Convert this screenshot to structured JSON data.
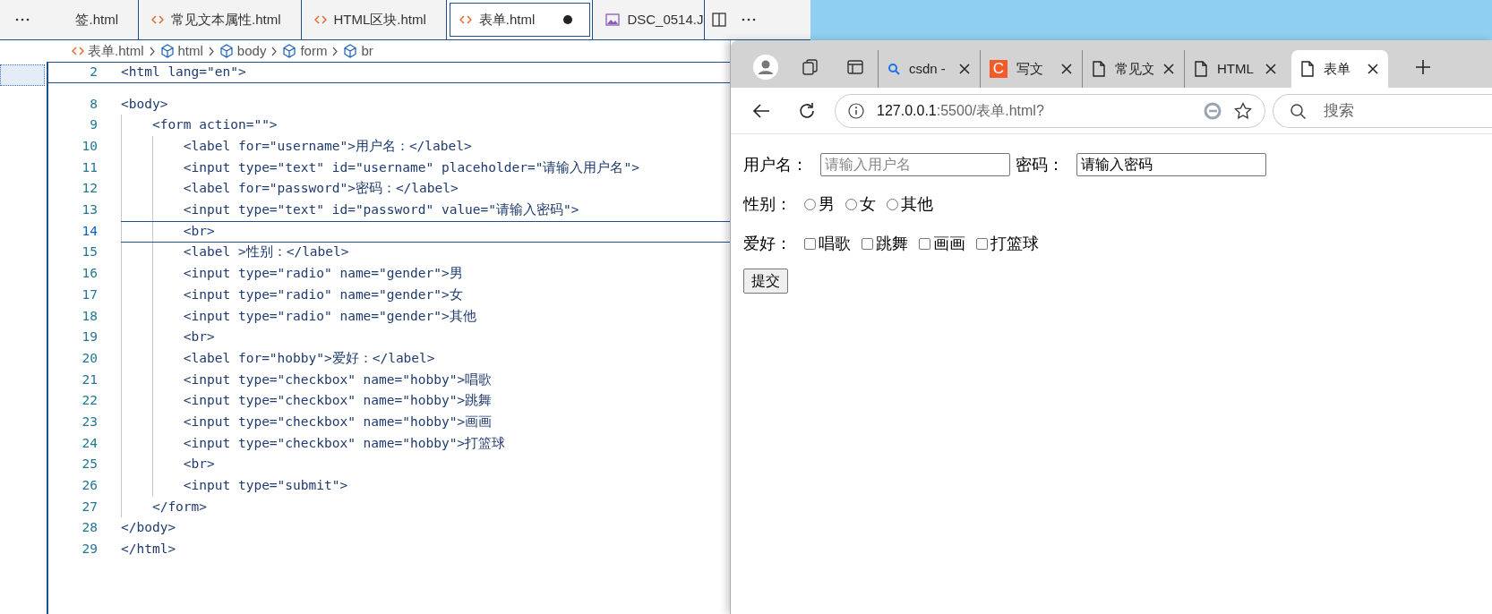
{
  "editor": {
    "tabs": [
      {
        "label": "签.html",
        "selected": false,
        "dirty": false
      },
      {
        "label": "常见文本属性.html",
        "kind": "code",
        "selected": false,
        "dirty": false
      },
      {
        "label": "HTML区块.html",
        "kind": "code",
        "selected": false,
        "dirty": false
      },
      {
        "label": "表单.html",
        "kind": "code",
        "selected": true,
        "dirty": true
      },
      {
        "label": "DSC_0514.J",
        "kind": "image",
        "selected": false,
        "dirty": false
      }
    ],
    "breadcrumbs": [
      {
        "label": "表单.html",
        "kind": "file"
      },
      {
        "label": "html",
        "kind": "element"
      },
      {
        "label": "body",
        "kind": "element"
      },
      {
        "label": "form",
        "kind": "element"
      },
      {
        "label": "br",
        "kind": "element"
      }
    ],
    "sticky_line": {
      "number": "2",
      "text": "<html lang=\"en\">"
    },
    "lines": [
      {
        "number": "8",
        "text": "<body>",
        "current": false
      },
      {
        "number": "9",
        "text": "    <form action=\"\">",
        "current": false
      },
      {
        "number": "10",
        "text": "        <label for=\"username\">用户名：</label>",
        "current": false
      },
      {
        "number": "11",
        "text": "        <input type=\"text\" id=\"username\" placeholder=\"请输入用户名\">",
        "current": false
      },
      {
        "number": "12",
        "text": "        <label for=\"password\">密码：</label>",
        "current": false
      },
      {
        "number": "13",
        "text": "        <input type=\"text\" id=\"password\" value=\"请输入密码\">",
        "current": false
      },
      {
        "number": "14",
        "text": "        <br>",
        "current": true
      },
      {
        "number": "15",
        "text": "        <label >性别：</label>",
        "current": false
      },
      {
        "number": "16",
        "text": "        <input type=\"radio\" name=\"gender\">男",
        "current": false
      },
      {
        "number": "17",
        "text": "        <input type=\"radio\" name=\"gender\">女",
        "current": false
      },
      {
        "number": "18",
        "text": "        <input type=\"radio\" name=\"gender\">其他",
        "current": false
      },
      {
        "number": "19",
        "text": "        <br>",
        "current": false
      },
      {
        "number": "20",
        "text": "        <label for=\"hobby\">爱好：</label>",
        "current": false
      },
      {
        "number": "21",
        "text": "        <input type=\"checkbox\" name=\"hobby\">唱歌",
        "current": false
      },
      {
        "number": "22",
        "text": "        <input type=\"checkbox\" name=\"hobby\">跳舞",
        "current": false
      },
      {
        "number": "23",
        "text": "        <input type=\"checkbox\" name=\"hobby\">画画",
        "current": false
      },
      {
        "number": "24",
        "text": "        <input type=\"checkbox\" name=\"hobby\">打篮球",
        "current": false
      },
      {
        "number": "25",
        "text": "        <br>",
        "current": false
      },
      {
        "number": "26",
        "text": "        <input type=\"submit\">",
        "current": false
      },
      {
        "number": "27",
        "text": "    </form>",
        "current": false
      },
      {
        "number": "28",
        "text": "</body>",
        "current": false
      },
      {
        "number": "29",
        "text": "</html>",
        "current": false
      }
    ]
  },
  "browser": {
    "tabs": [
      {
        "label": "csdn -",
        "kind": "search",
        "selected": false
      },
      {
        "label": "写文",
        "kind": "letter",
        "favicon_text": "C",
        "selected": false
      },
      {
        "label": "常见文",
        "kind": "page",
        "selected": false
      },
      {
        "label": "HTML",
        "kind": "page",
        "selected": false
      },
      {
        "label": "表单",
        "kind": "page",
        "selected": true
      }
    ],
    "address": {
      "host": "127.0.0.1",
      "rest": ":5500/表单.html?"
    },
    "search": {
      "placeholder": "搜索"
    },
    "form_rows": [
      [
        {
          "kind": "label",
          "text": "用户名："
        },
        {
          "kind": "text_input",
          "placeholder": "请输入用户名"
        },
        {
          "kind": "label",
          "text": "密码："
        },
        {
          "kind": "text_input",
          "value": "请输入密码"
        }
      ],
      [
        {
          "kind": "label",
          "text": "性别："
        },
        {
          "kind": "radio",
          "text": "男",
          "checked": false
        },
        {
          "kind": "radio",
          "text": "女",
          "checked": false
        },
        {
          "kind": "radio",
          "text": "其他",
          "checked": false
        }
      ],
      [
        {
          "kind": "label",
          "text": "爱好："
        },
        {
          "kind": "checkbox",
          "text": "唱歌",
          "checked": false
        },
        {
          "kind": "checkbox",
          "text": "跳舞",
          "checked": false
        },
        {
          "kind": "checkbox",
          "text": "画画",
          "checked": false
        },
        {
          "kind": "checkbox",
          "text": "打篮球",
          "checked": false
        }
      ],
      [
        {
          "kind": "submit",
          "text": "提交"
        }
      ]
    ]
  }
}
